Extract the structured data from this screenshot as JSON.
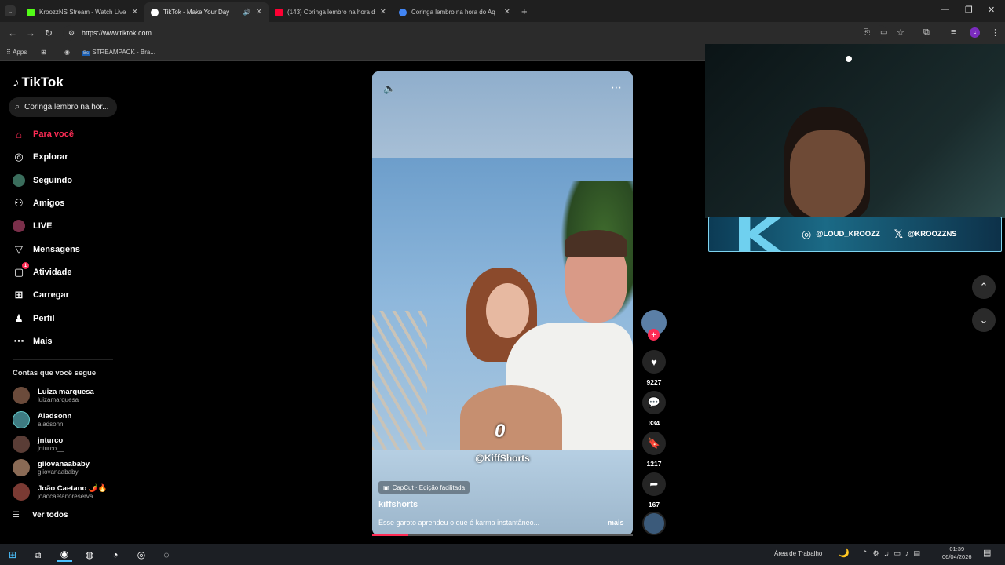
{
  "browser": {
    "tabs": [
      {
        "title": "KroozzNS Stream - Watch Live",
        "color": "#53fc18"
      },
      {
        "title": "TikTok - Make Your Day",
        "color": "#ffffff"
      },
      {
        "title": "(143) Coringa lembro na hora d",
        "color": "#ff0033"
      },
      {
        "title": "Coringa lembro na hora do Aq",
        "color": "#4285f4"
      }
    ],
    "url": "https://www.tiktok.com",
    "bookmarks": {
      "apps": "Apps",
      "streampack": "STREAMPACK - Bra..."
    }
  },
  "tiktok": {
    "logo": "TikTok",
    "search_value": "Coringa lembro na hor...",
    "menu": [
      {
        "label": "Para você",
        "icon": "home-icon"
      },
      {
        "label": "Explorar",
        "icon": "compass-icon"
      },
      {
        "label": "Seguindo",
        "icon": "following-icon"
      },
      {
        "label": "Amigos",
        "icon": "friends-icon"
      },
      {
        "label": "LIVE",
        "icon": "live-icon"
      },
      {
        "label": "Mensagens",
        "icon": "message-icon"
      },
      {
        "label": "Atividade",
        "icon": "activity-icon",
        "badge": "1"
      },
      {
        "label": "Carregar",
        "icon": "upload-icon"
      },
      {
        "label": "Perfil",
        "icon": "profile-icon"
      },
      {
        "label": "Mais",
        "icon": "more-icon"
      }
    ],
    "following_title": "Contas que você segue",
    "accounts": [
      {
        "name": "Luiza marquesa",
        "user": "luizamarquesa"
      },
      {
        "name": "Aladsonn",
        "user": "aladsonn"
      },
      {
        "name": "jnturco__",
        "user": "jnturco__"
      },
      {
        "name": "giiovanaababy",
        "user": "giiovanaababy"
      },
      {
        "name": "João Caetano 🌶️🔥",
        "user": "joaocaetanoreserva"
      }
    ],
    "see_all": "Ver todos",
    "video": {
      "overlay_handle": "@KiffShorts",
      "overlay_digit": "0",
      "capcut": "CapCut · Edição facilitada",
      "author": "kiffshorts",
      "caption": "Esse garoto aprendeu o que é karma instantâneo...",
      "more": "mais",
      "progress": 0.14
    },
    "actions": {
      "likes": "9227",
      "comments": "334",
      "saves": "1217",
      "shares": "167"
    }
  },
  "stream_overlay": {
    "instagram": "@LOUD_KROOZZ",
    "x": "@KROOZZNS",
    "logo_letter": "K"
  },
  "taskbar": {
    "desktop": "Área de Trabalho",
    "time": "01:39",
    "date": "06/04/2026"
  },
  "colors": {
    "accent": "#fe2c55"
  }
}
